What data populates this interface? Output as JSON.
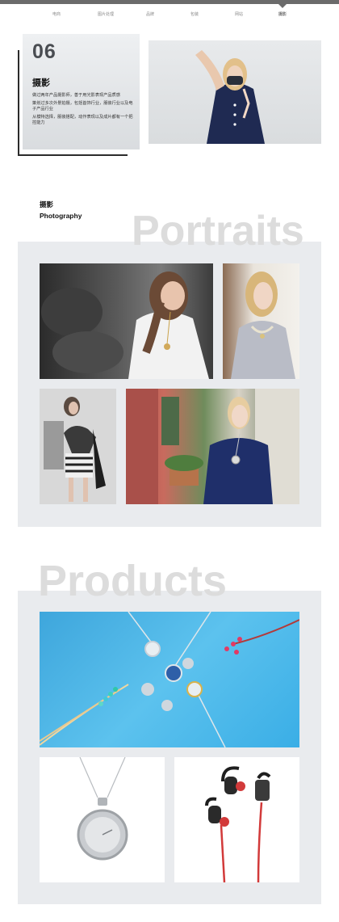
{
  "nav": {
    "items": [
      {
        "label": "电商"
      },
      {
        "label": "图片处理"
      },
      {
        "label": "品牌"
      },
      {
        "label": "包装"
      },
      {
        "label": "网站"
      },
      {
        "label": "摄影"
      }
    ],
    "active_index": 5
  },
  "intro": {
    "number": "06",
    "title": "摄影",
    "lines": [
      "做过两年产品摄影师，善于用光影表现产品质感",
      "策划过多次外景拍摄，包括首饰行业，服装行业以及电子产品行业",
      "从模特选择，服装搭配，动作表现以及成片都有一个把控能力"
    ]
  },
  "photography": {
    "title_cn": "摄影",
    "title_en": "Photography",
    "watermark": "Portraits"
  },
  "products": {
    "watermark": "Products"
  },
  "colors": {
    "topbar": "#6b6b6b",
    "panel": "#e9ebee",
    "watermark": "#dcdcdc",
    "product_backdrop": "#4bb4e6"
  }
}
